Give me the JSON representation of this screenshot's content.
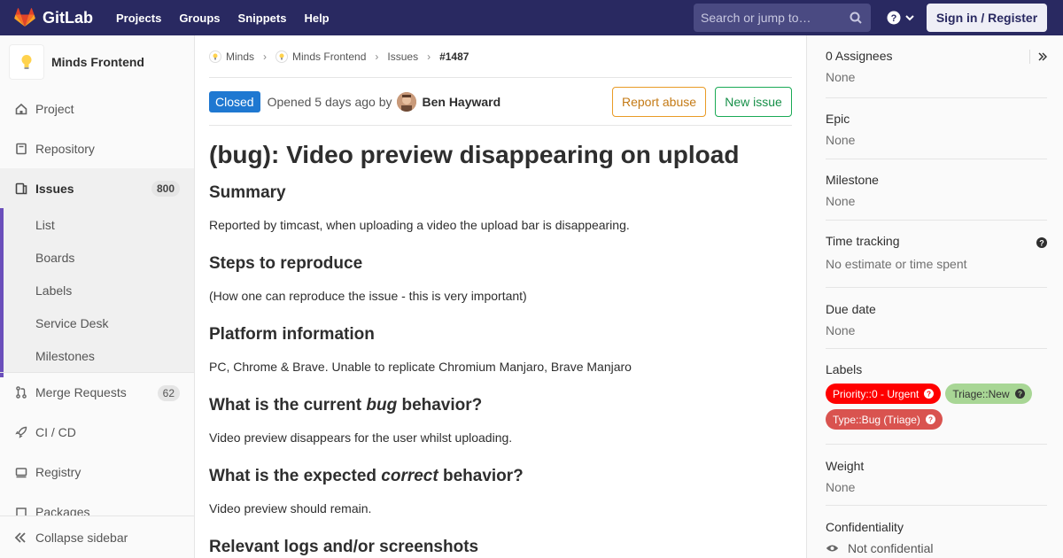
{
  "app": {
    "brand": "GitLab"
  },
  "nav": {
    "links": [
      "Projects",
      "Groups",
      "Snippets",
      "Help"
    ],
    "search_placeholder": "Search or jump to…",
    "signin_label": "Sign in / Register"
  },
  "sidebar": {
    "project_name": "Minds Frontend",
    "items": {
      "project": "Project",
      "repository": "Repository",
      "issues": "Issues",
      "issues_count": "800",
      "merge_requests": "Merge Requests",
      "merge_requests_count": "62",
      "cicd": "CI / CD",
      "registry": "Registry",
      "packages": "Packages"
    },
    "issue_subitems": [
      "List",
      "Boards",
      "Labels",
      "Service Desk",
      "Milestones"
    ],
    "collapse_label": "Collapse sidebar"
  },
  "breadcrumb": {
    "group": "Minds",
    "project": "Minds Frontend",
    "issues": "Issues",
    "current": "#1487"
  },
  "issue": {
    "status": "Closed",
    "opened_text": "Opened 5 days ago by",
    "author": "Ben Hayward",
    "report_label": "Report abuse",
    "new_issue_label": "New issue",
    "title": "(bug): Video preview disappearing on upload",
    "sections": {
      "summary_heading": "Summary",
      "summary_text": "Reported by timcast, when uploading a video the upload bar is disappearing.",
      "steps_heading": "Steps to reproduce",
      "steps_text": "(How one can reproduce the issue - this is very important)",
      "platform_heading": "Platform information",
      "platform_text": "PC, Chrome & Brave. Unable to replicate Chromium Manjaro, Brave Manjaro",
      "current_pre": "What is the current ",
      "current_em": "bug",
      "current_post": " behavior?",
      "current_text": "Video preview disappears for the user whilst uploading.",
      "expected_pre": "What is the expected ",
      "expected_em": "correct",
      "expected_post": " behavior?",
      "expected_text": "Video preview should remain.",
      "logs_heading": "Relevant logs and/or screenshots"
    }
  },
  "right": {
    "assignees_title": "0 Assignees",
    "assignees_value": "None",
    "epic_title": "Epic",
    "epic_value": "None",
    "milestone_title": "Milestone",
    "milestone_value": "None",
    "time_title": "Time tracking",
    "time_value": "No estimate or time spent",
    "due_title": "Due date",
    "due_value": "None",
    "labels_title": "Labels",
    "labels": [
      "Priority::0 - Urgent",
      "Triage::New",
      "Type::Bug (Triage)"
    ],
    "weight_title": "Weight",
    "weight_value": "None",
    "conf_title": "Confidentiality",
    "conf_value": "Not confidential"
  },
  "colors": {
    "navbar": "#292961",
    "active_accent": "#6b4fbb",
    "status_closed": "#1f78d1",
    "label_priority": "#ff0000",
    "label_triage": "#a8d695",
    "label_type": "#d9534f"
  },
  "icons": [
    "gitlab-logo-icon",
    "search-icon",
    "help-icon",
    "chevron-down-icon",
    "home-icon",
    "book-icon",
    "issues-icon",
    "merge-request-icon",
    "rocket-icon",
    "container-icon",
    "package-icon",
    "collapse-icon",
    "expand-right-icon",
    "question-circle-icon",
    "eye-icon"
  ]
}
